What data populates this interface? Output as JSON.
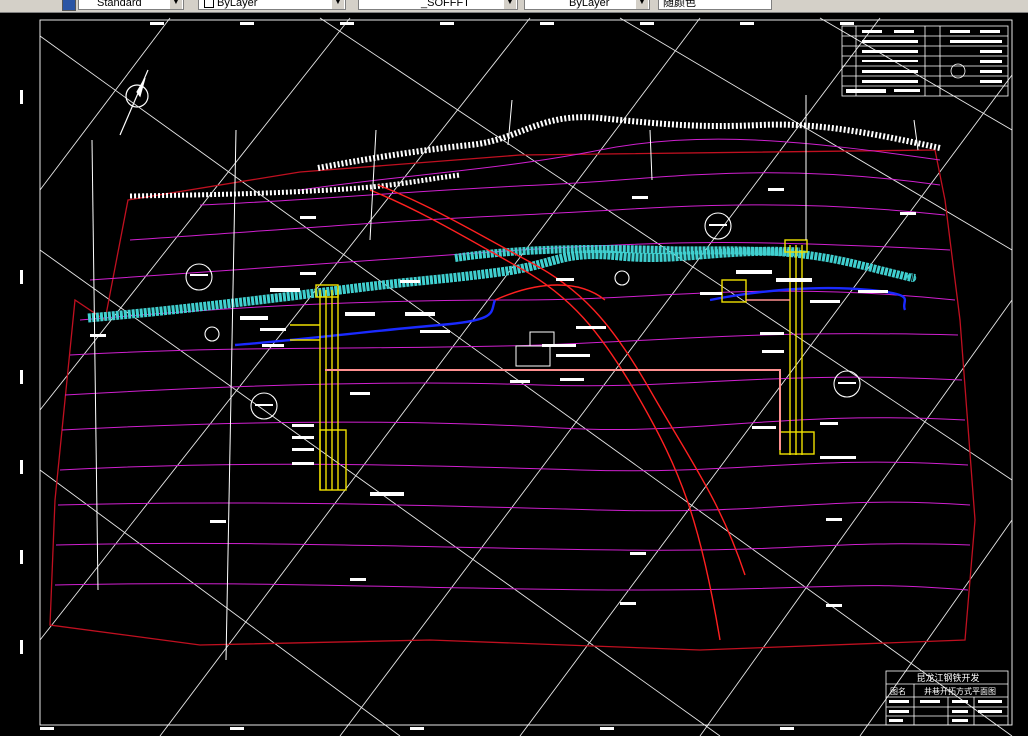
{
  "toolbar": {
    "text_style": "Standard",
    "color": "ByLayer",
    "linetype": "_SOFFFT",
    "lineweight": "ByLayer",
    "plot_style": "随颜色"
  },
  "title_block": {
    "company": "昆龙江钢铁开发",
    "drawing_label": "图名",
    "drawing_title": "井巷开拓方式平面图"
  }
}
